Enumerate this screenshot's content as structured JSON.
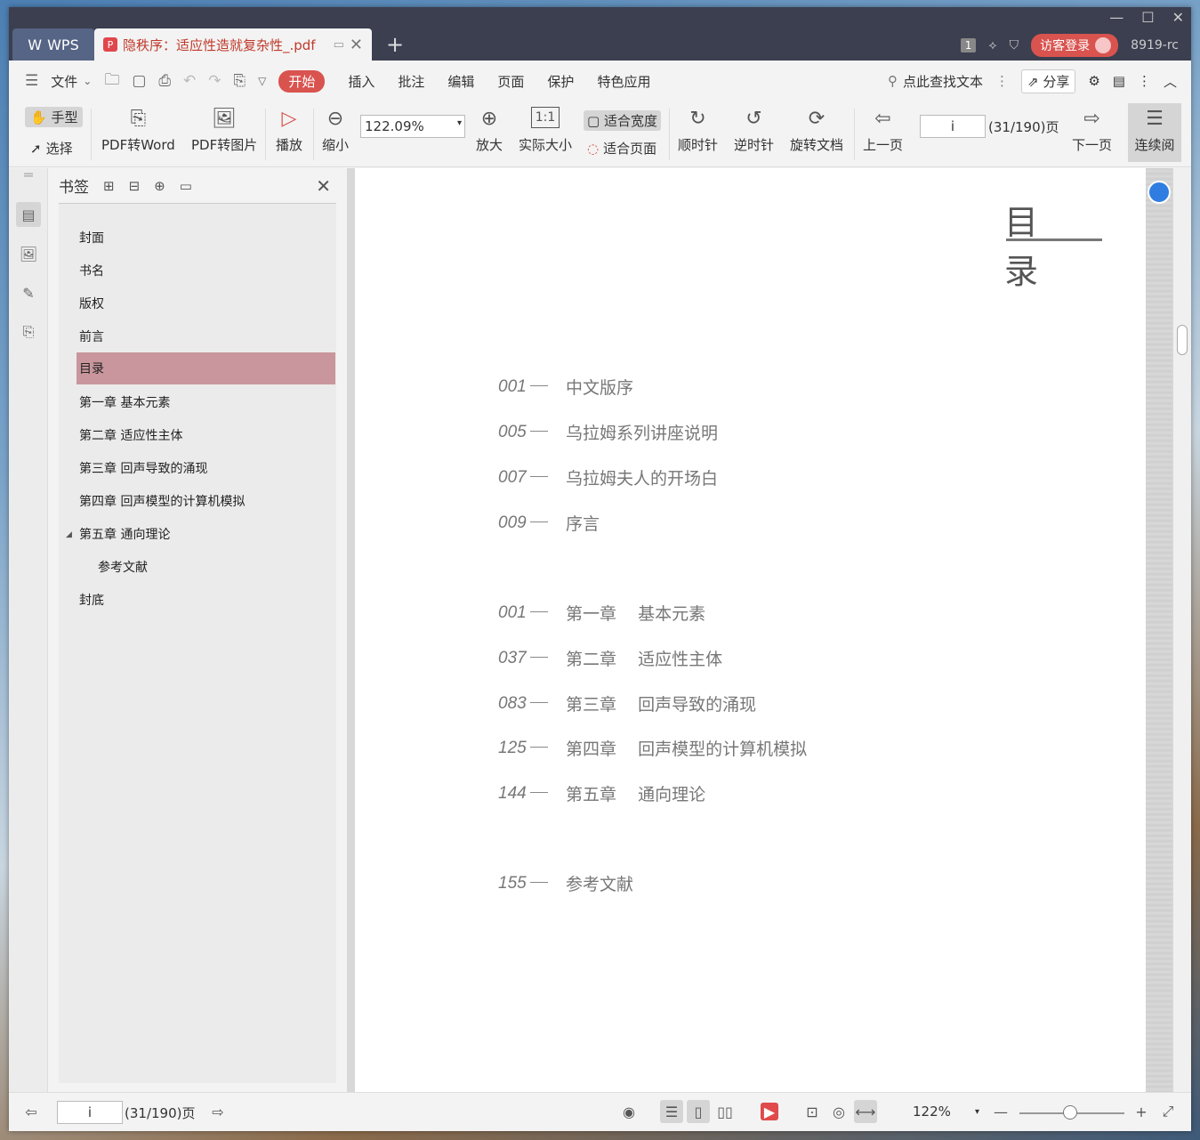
{
  "tabbar": {
    "app_tab": "WPS",
    "doc_tab": "隐秩序：适应性造就复杂性_.pdf",
    "page_badge": "1",
    "login": "访客登录",
    "user": "8919-rc"
  },
  "menu": {
    "file": "文件",
    "items": [
      "开始",
      "插入",
      "批注",
      "编辑",
      "页面",
      "保护",
      "特色应用"
    ],
    "search": "点此查找文本",
    "share": "分享"
  },
  "ribbon": {
    "hand": "手型",
    "select": "选择",
    "pdf_to_word": "PDF转Word",
    "pdf_to_image": "PDF转图片",
    "play": "播放",
    "zoom_out": "缩小",
    "zoom_value": "122.09%",
    "zoom_in": "放大",
    "actual_size": "实际大小",
    "fit_width": "适合宽度",
    "fit_page": "适合页面",
    "rotate_cw": "顺时针",
    "rotate_ccw": "逆时针",
    "rotate_doc": "旋转文档",
    "prev_page": "上一页",
    "page_input": "i",
    "page_count": "(31/190)页",
    "next_page": "下一页",
    "continuous": "连续阅"
  },
  "bookmarks": {
    "title": "书签",
    "items": [
      "封面",
      "书名",
      "版权",
      "前言",
      "目录",
      "第一章  基本元素",
      "第二章  适应性主体",
      "第三章  回声导致的涌现",
      "第四章  回声模型的计算机模拟",
      "第五章  通向理论",
      "参考文献",
      "封底"
    ]
  },
  "page": {
    "title": "目 录",
    "toc": [
      {
        "num": "001",
        "text": "中文版序"
      },
      {
        "num": "005",
        "text": "乌拉姆系列讲座说明"
      },
      {
        "num": "007",
        "text": "乌拉姆夫人的开场白"
      },
      {
        "num": "009",
        "text": "序言"
      },
      {
        "num": "001",
        "text": "第一章    基本元素"
      },
      {
        "num": "037",
        "text": "第二章    适应性主体"
      },
      {
        "num": "083",
        "text": "第三章    回声导致的涌现"
      },
      {
        "num": "125",
        "text": "第四章    回声模型的计算机模拟"
      },
      {
        "num": "144",
        "text": "第五章    通向理论"
      },
      {
        "num": "155",
        "text": "参考文献"
      }
    ]
  },
  "status": {
    "page_input": "i",
    "page_count": "(31/190)页",
    "zoom": "122%"
  },
  "colors": {
    "accent": "#d9534f",
    "bookmark_selected": "#c8969c",
    "tabbar": "#3b3f4f"
  }
}
